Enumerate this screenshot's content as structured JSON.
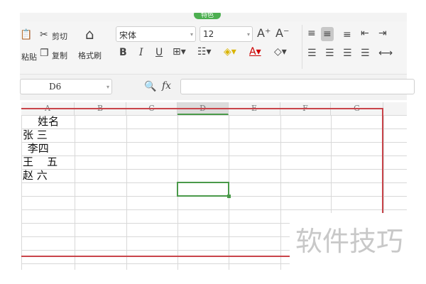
{
  "tabs": {
    "special": "特色"
  },
  "clipboard": {
    "cut": "剪切",
    "copy": "复制",
    "paste": "粘贴",
    "format_painter": "格式刷"
  },
  "font": {
    "name": "宋体",
    "size": "12"
  },
  "namebox": {
    "value": "D6"
  },
  "formula": {
    "fx": "fx",
    "value": ""
  },
  "columns": [
    "A",
    "B",
    "C",
    "D",
    "E",
    "F",
    "G"
  ],
  "cells": [
    "    姓名",
    "张 三",
    " 李四",
    "王    五",
    "赵 六"
  ],
  "selected_cell": "D6",
  "watermark": "软件技巧",
  "colors": {
    "selection": "#4a9a4a",
    "red_box": "#c9444a"
  }
}
